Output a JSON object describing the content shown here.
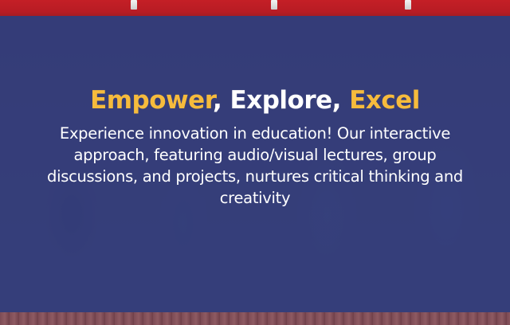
{
  "headline": {
    "word1": "Empower",
    "sep1": ", ",
    "word2": "Explore",
    "sep2": ", ",
    "word3": "Excel"
  },
  "body": "Experience innovation in education! Our interactive approach, featuring audio/visual lectures, group discussions, and projects, nurtures critical thinking and creativity",
  "colors": {
    "accent": "#f6bb3c",
    "overlay": "#343c78",
    "curtain": "#c41f26",
    "text": "#ffffff"
  }
}
